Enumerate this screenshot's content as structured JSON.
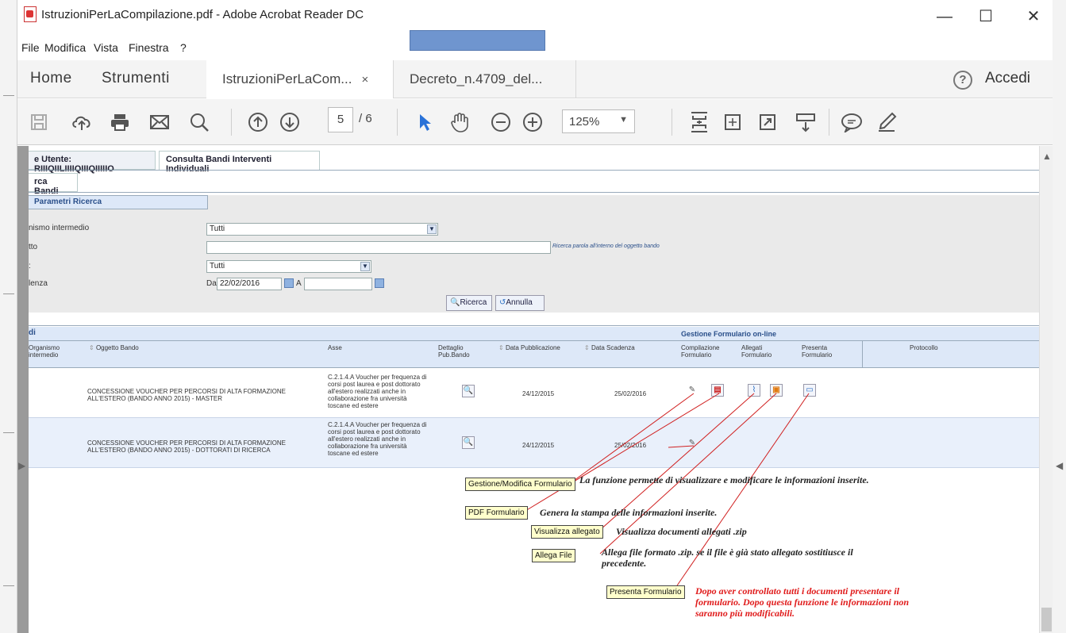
{
  "window": {
    "title": "IstruzioniPerLaCompilazione.pdf - Adobe Acrobat Reader DC",
    "controls": [
      "—",
      "☐",
      "✕"
    ]
  },
  "menu": [
    "File",
    "Modifica",
    "Vista",
    "Finestra",
    "?"
  ],
  "nav": {
    "home": "Home",
    "tools": "Strumenti",
    "tabs": [
      {
        "label": "IstruzioniPerLaCom...",
        "close": "×"
      },
      {
        "label": "Decreto_n.4709_del..."
      }
    ],
    "help": "?",
    "login": "Accedi"
  },
  "toolbar": {
    "page_current": "5",
    "page_total": "/ 6",
    "zoom": "125%"
  },
  "doc": {
    "tabs": [
      "e Utente: RIIIQIILIIIIQIIIQIIIIIO",
      "Consulta Bandi Interventi Individuali"
    ],
    "subtab": "rca Bandi",
    "params_header": "Parametri Ricerca",
    "fields": [
      {
        "label": "nismo intermedio",
        "value": "Tutti"
      },
      {
        "label": "tto",
        "value": "",
        "hint": "Ricerca parola all'interno del oggetto bando"
      },
      {
        "label": ":",
        "value": "Tutti"
      },
      {
        "label": "lenza",
        "from_label": "Da",
        "from": "22/02/2016",
        "to_label": "A",
        "to": ""
      }
    ],
    "btn_search": "Ricerca",
    "btn_cancel": "Annulla",
    "results_header": "di",
    "gestione_header": "Gestione Formulario on-line",
    "columns": [
      "Organismo intermedio",
      "Oggetto Bando",
      "Asse",
      "Dettaglio Pub.Bando",
      "Data Pubblicazione",
      "Data Scadenza",
      "Compilazione Formulario",
      "Allegati Formulario",
      "Presenta Formulario",
      "Protocollo"
    ],
    "rows": [
      {
        "oggetto": "CONCESSIONE VOUCHER PER PERCORSI DI ALTA FORMAZIONE ALL'ESTERO (BANDO ANNO 2015) - MASTER",
        "asse": "C.2.1.4.A Voucher per frequenza di corsi post laurea e post dottorato all'estero realizzati anche in collaborazione fra università toscane ed estere",
        "pub": "24/12/2015",
        "scad": "25/02/2016"
      },
      {
        "oggetto": "CONCESSIONE VOUCHER PER PERCORSI DI ALTA FORMAZIONE ALL'ESTERO (BANDO ANNO 2015) - DOTTORATI DI RICERCA",
        "asse": "C.2.1.4.A Voucher per frequenza di corsi post laurea e post dottorato all'estero realizzati anche in collaborazione fra università toscane ed estere",
        "pub": "24/12/2015",
        "scad": "25/02/2016"
      }
    ],
    "callouts": [
      {
        "label": "Gestione/Modifica Formulario",
        "text": "La funzione permette di visualizzare e modificare le informazioni inserite."
      },
      {
        "label": "PDF Formulario",
        "text": "Genera la stampa delle informazioni inserite."
      },
      {
        "label": "Visualizza allegato",
        "text": "Visualizza documenti allegati .zip"
      },
      {
        "label": "Allega File",
        "text": "Allega file formato .zip. se il file è già stato allegato sostitiusce il precedente."
      },
      {
        "label": "Presenta Formulario",
        "text": "Dopo aver controllato tutti i documenti presentare il formulario. Dopo questa funzione le informazioni non saranno più modificabili."
      }
    ],
    "colors": {
      "header_bg": "#dde8f8",
      "row_alt": "#e9f0fb",
      "accent": "#3060a0",
      "warning": "#e01b1b"
    }
  }
}
